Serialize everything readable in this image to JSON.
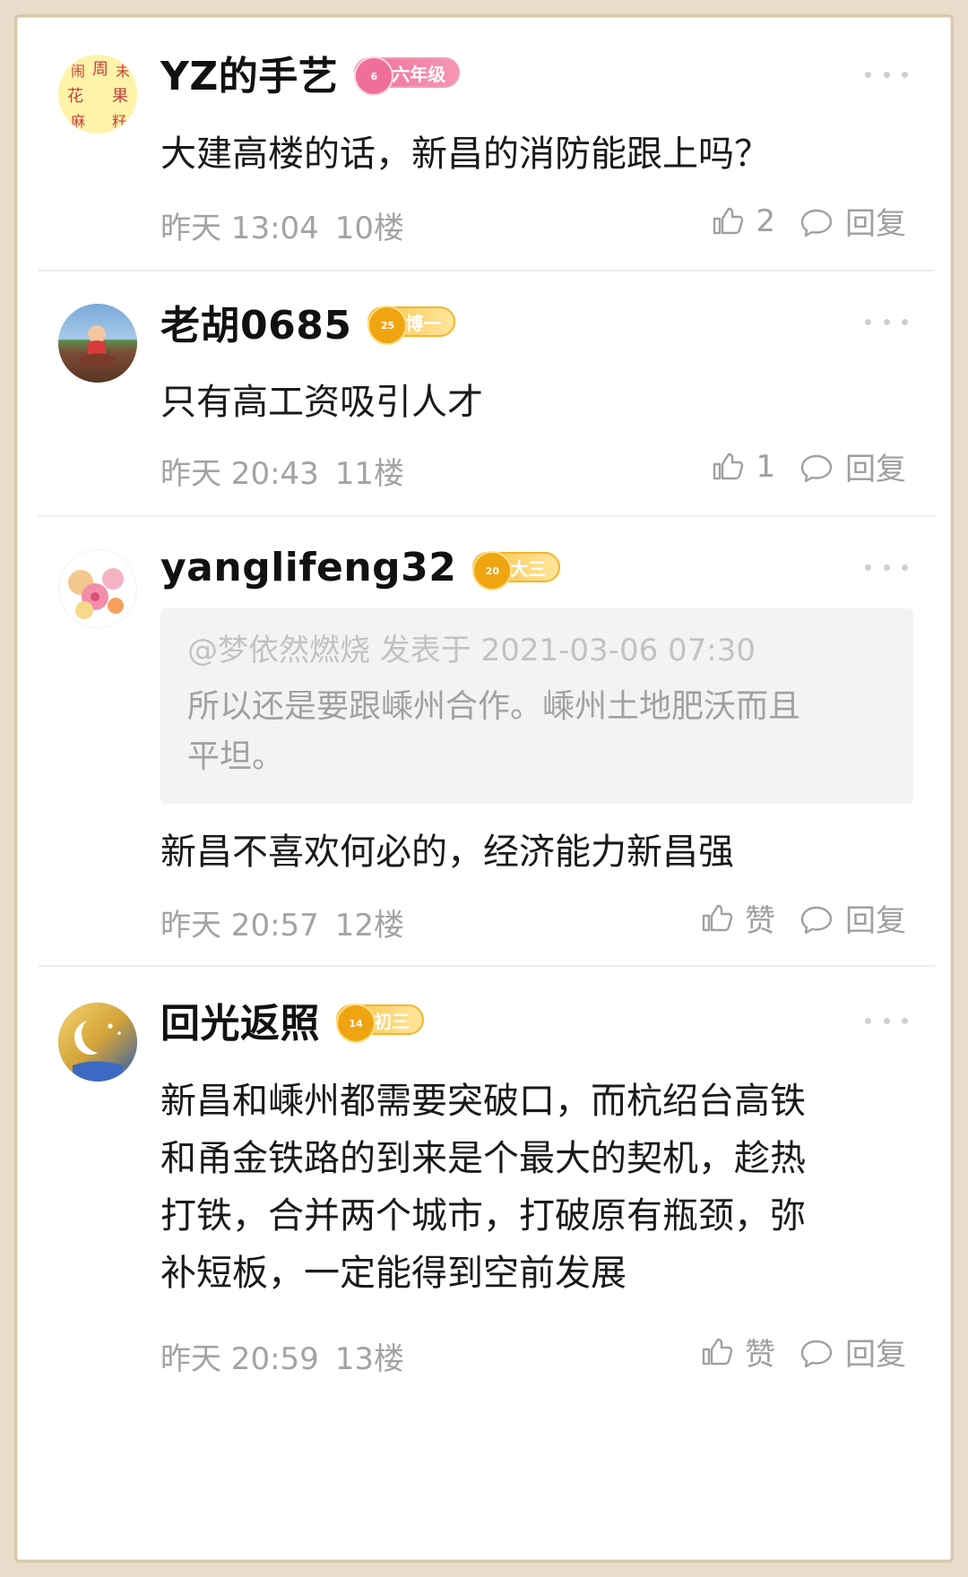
{
  "comments": [
    {
      "username": "YZ的手艺",
      "badge": {
        "text": "六年级",
        "number": "6",
        "style": "pink"
      },
      "content": "大建高楼的话，新昌的消防能跟上吗？",
      "time": "昨天 13:04",
      "floor": "10楼",
      "like": "2",
      "reply": "回复",
      "avatar": {
        "chars": [
          "闹",
          "周",
          "末",
          "花",
          "果",
          "麻",
          "籽"
        ],
        "background": "#fff3a8",
        "char_color": "#c43f3f"
      }
    },
    {
      "username": "老胡0685",
      "badge": {
        "text": "博一",
        "number": "25",
        "style": "gold"
      },
      "content": "只有高工资吸引人才",
      "time": "昨天 20:43",
      "floor": "11楼",
      "like": "1",
      "reply": "回复",
      "avatar": {
        "style": "child-photo"
      }
    },
    {
      "username": "yanglifeng32",
      "badge": {
        "text": "大三",
        "number": "20",
        "style": "gold"
      },
      "quote": {
        "meta": "@梦依然燃烧 发表于 2021-03-06 07:30",
        "body": "所以还是要跟嵊州合作。嵊州土地肥沃而且\n平坦。"
      },
      "content": "新昌不喜欢何必的，经济能力新昌强",
      "time": "昨天 20:57",
      "floor": "12楼",
      "like": "赞",
      "reply": "回复",
      "avatar": {
        "style": "floral"
      }
    },
    {
      "username": "回光返照",
      "badge": {
        "text": "初三",
        "number": "14",
        "style": "gold"
      },
      "content": "新昌和嵊州都需要突破口，而杭绍台高铁\n和甬金铁路的到来是个最大的契机，趁热\n打铁，合并两个城市，打破原有瓶颈，弥\n补短板，一定能得到空前发展",
      "time": "昨天 20:59",
      "floor": "13楼",
      "like": "赞",
      "reply": "回复",
      "avatar": {
        "style": "night-moon"
      }
    }
  ],
  "icons": {
    "more": "more-icon",
    "like": "thumbs-up-icon",
    "reply": "comment-bubble-icon"
  },
  "colors": {
    "page_bg": "#e9dccb",
    "text": "#1a1a1a",
    "meta": "#a3a3a3",
    "quote_bg": "#f3f3f3"
  }
}
